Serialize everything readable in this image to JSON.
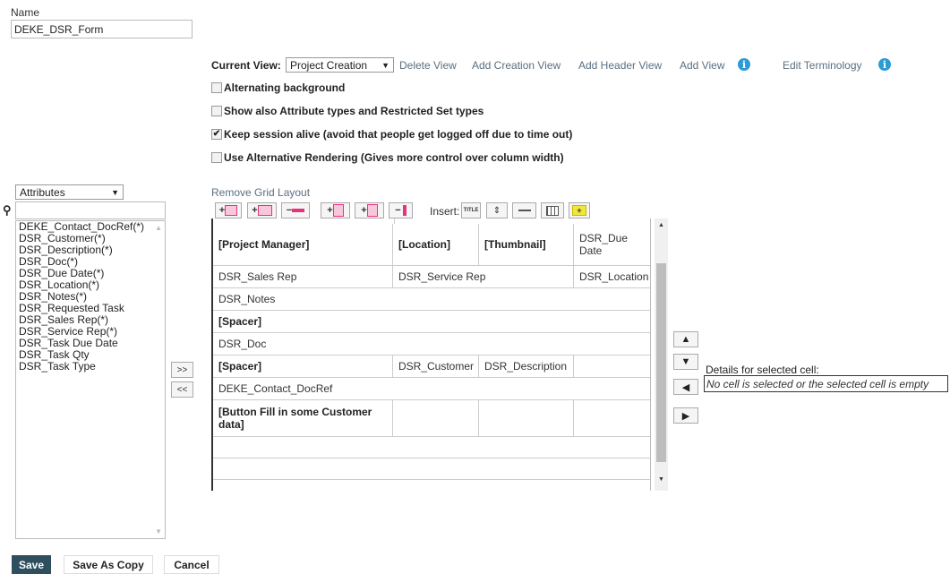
{
  "name": {
    "label": "Name",
    "value": "DEKE_DSR_Form"
  },
  "view": {
    "current_label": "Current View:",
    "current_value": "Project Creation",
    "links": [
      "Delete View",
      "Add Creation View",
      "Add Header View",
      "Add View"
    ],
    "edit_terminology": "Edit Terminology"
  },
  "options": [
    {
      "label": "Alternating background",
      "checked": false
    },
    {
      "label": "Show also Attribute types and Restricted Set types",
      "checked": false
    },
    {
      "label": "Keep session alive (avoid that people get logged off due to time out)",
      "checked": true
    },
    {
      "label": "Use Alternative Rendering (Gives more control over column width)",
      "checked": false
    }
  ],
  "attributes": {
    "dropdown": "Attributes",
    "search_placeholder": "",
    "items": [
      "DEKE_Contact_DocRef(*)",
      "DSR_Customer(*)",
      "DSR_Description(*)",
      "DSR_Doc(*)",
      "DSR_Due Date(*)",
      "DSR_Location(*)",
      "DSR_Notes(*)",
      "DSR_Requested Task",
      "DSR_Sales Rep(*)",
      "DSR_Service Rep(*)",
      "DSR_Task Due Date",
      "DSR_Task Qty",
      "DSR_Task Type"
    ]
  },
  "transfer": {
    "add": ">>",
    "remove": "<<"
  },
  "grid": {
    "remove_layout": "Remove Grid Layout",
    "insert_label": "Insert:",
    "insert_title": "TITLE",
    "cells": {
      "r1c1": "[Project Manager]",
      "r1c2": "[Location]",
      "r1c3": "[Thumbnail]",
      "r1c4": "DSR_Due Date",
      "r2c1": "DSR_Sales Rep",
      "r2c2": "DSR_Service Rep",
      "r2c4": "DSR_Location",
      "r3": "DSR_Notes",
      "r4": "[Spacer]",
      "r5": "DSR_Doc",
      "r6c1": "[Spacer]",
      "r6c2": "DSR_Customer",
      "r6c3": "DSR_Description",
      "r7": "DEKE_Contact_DocRef",
      "r8c1": "[Button Fill in some Customer data]"
    }
  },
  "details": {
    "label": "Details for selected cell:",
    "value": "No cell is selected or the selected cell is empty"
  },
  "buttons": {
    "save": "Save",
    "save_as_copy": "Save As Copy",
    "cancel": "Cancel"
  },
  "colors": {
    "link": "#5b6f80",
    "info": "#2d9bd6",
    "save_bg": "#2f4f5f",
    "insert_yellow": "#f0e63c",
    "add_pink": "#e6337f"
  }
}
